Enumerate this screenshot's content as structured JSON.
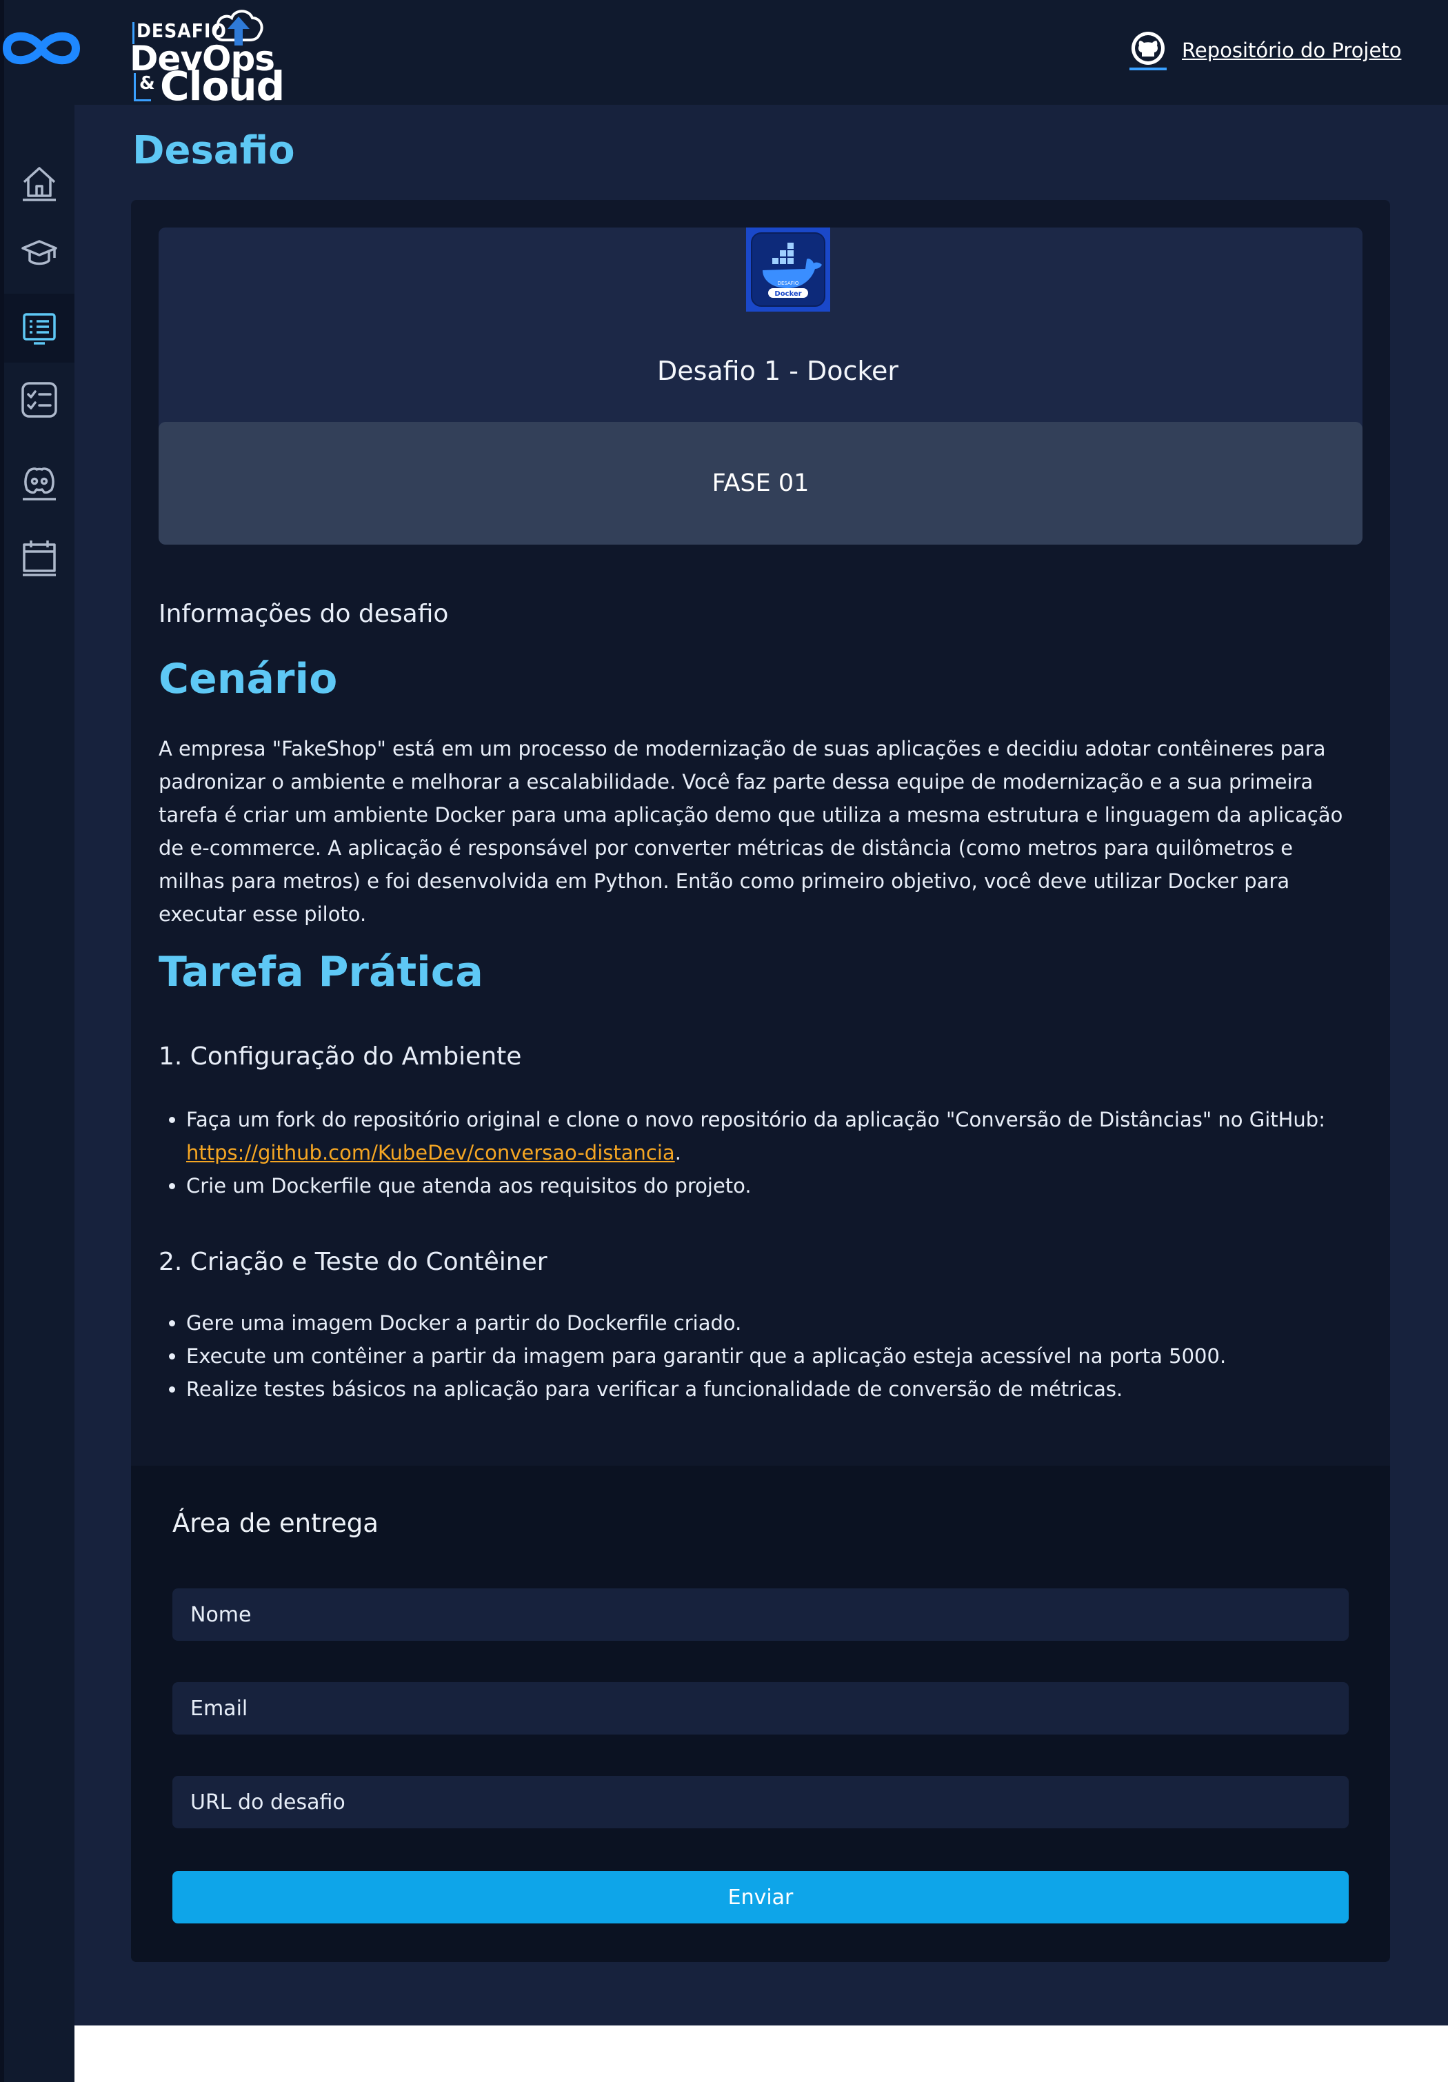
{
  "header": {
    "logo": {
      "line1": "DESAFIO",
      "line2": "DevOps",
      "amp": "&",
      "line3": "Cloud"
    },
    "repo_link": "Repositório do Projeto"
  },
  "sidebar": {
    "items": [
      {
        "icon": "home-icon",
        "active": false
      },
      {
        "icon": "graduation-cap-icon",
        "active": false
      },
      {
        "icon": "list-board-icon",
        "active": true
      },
      {
        "icon": "checklist-icon",
        "active": false
      },
      {
        "icon": "discord-icon",
        "active": false
      },
      {
        "icon": "calendar-icon",
        "active": false
      }
    ]
  },
  "page": {
    "title": "Desafio"
  },
  "challenge": {
    "thumb_label_small": "DESAFIO",
    "thumb_label": "Docker",
    "title": "Desafio 1 - Docker",
    "phase": "FASE 01",
    "info_label": "Informações do desafio",
    "scenario_heading": "Cenário",
    "scenario_text": "A empresa \"FakeShop\" está em um processo de modernização de suas aplicações e decidiu adotar contêineres para padronizar o ambiente e melhorar a escalabilidade. Você faz parte dessa equipe de modernização e a sua primeira tarefa é criar um ambiente Docker para uma aplicação demo que utiliza a mesma estrutura e linguagem da aplicação de e-commerce. A aplicação é responsável por converter métricas de distância (como metros para quilômetros e milhas para metros) e foi desenvolvida em Python. Então como primeiro objetivo, você deve utilizar Docker para executar esse piloto.",
    "task_heading": "Tarefa Prática",
    "step1_heading": "1. Configuração do Ambiente",
    "step1_item1": "Faça um fork do repositório original e clone o novo repositório da aplicação \"Conversão de Distâncias\" no GitHub:",
    "step1_link": "https://github.com/KubeDev/conversao-distancia",
    "step1_link_suffix": ".",
    "step1_item2": "Crie um Dockerfile que atenda aos requisitos do projeto.",
    "step2_heading": "2. Criação e Teste do Contêiner",
    "step2_items": [
      "Gere uma imagem Docker a partir do Dockerfile criado.",
      "Execute um contêiner a partir da imagem para garantir que a aplicação esteja acessível na porta 5000.",
      "Realize testes básicos na aplicação para verificar a funcionalidade de conversão de métricas."
    ]
  },
  "delivery": {
    "title": "Área de entrega",
    "name_placeholder": "Nome",
    "email_placeholder": "Email",
    "url_placeholder": "URL do desafio",
    "submit_label": "Enviar"
  },
  "colors": {
    "accent_heading": "#5ec8f5",
    "submit_button": "#0ea5e9",
    "link": "#f5a623",
    "background": "#17223d"
  }
}
